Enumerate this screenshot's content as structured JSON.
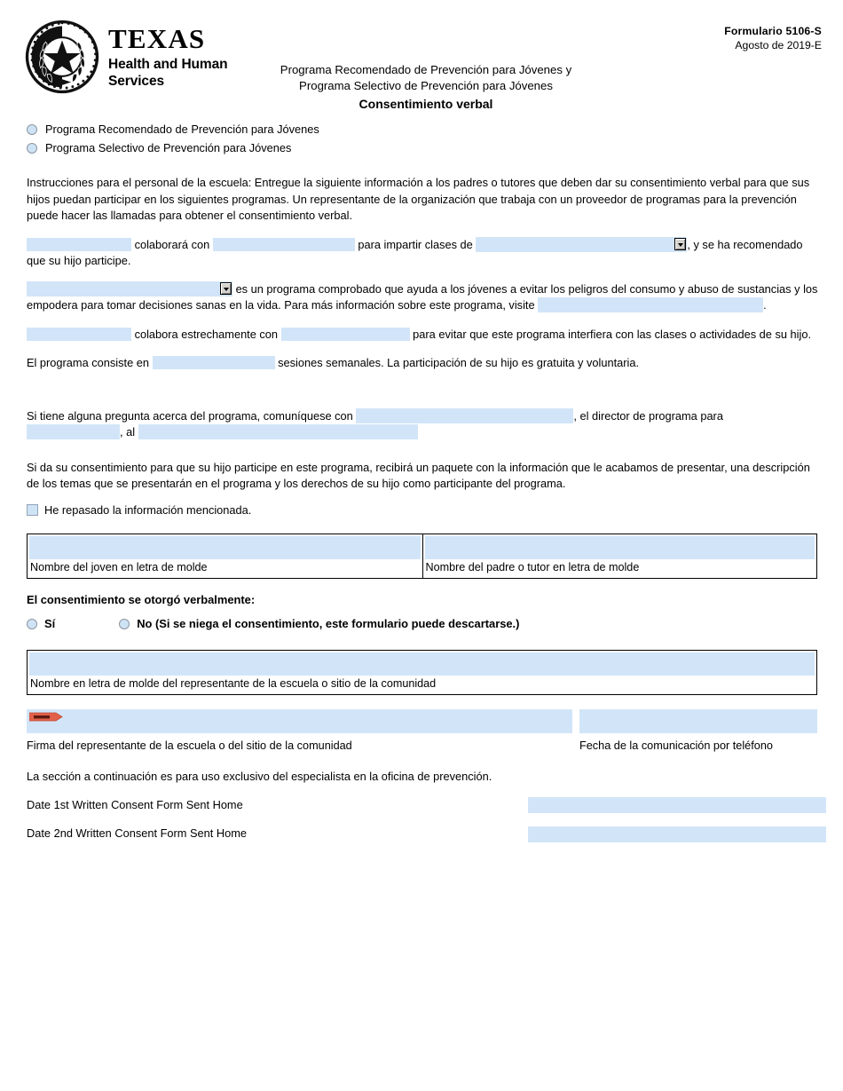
{
  "header": {
    "logo": {
      "seal_icon": "texas-state-seal-icon",
      "brand_primary": "TEXAS",
      "brand_secondary_line1": "Health and Human",
      "brand_secondary_line2": "Services"
    },
    "form_number": "Formulario  5106-S",
    "form_date": "Agosto de 2019-E",
    "title_line1": "Programa Recomendado de Prevención para Jóvenes y",
    "title_line2": "Programa Selectivo de Prevención para Jóvenes",
    "title_main": "Consentimiento verbal"
  },
  "program_options": [
    {
      "label": "Programa Recomendado de Prevención para Jóvenes",
      "selected": false
    },
    {
      "label": "Programa Selectivo de Prevención para Jóvenes",
      "selected": false
    }
  ],
  "instructions": "Instrucciones para el personal de la escuela: Entregue la siguiente información a los padres o tutores que deben dar su consentimiento verbal para que sus hijos puedan participar en los siguientes programas. Un representante de la organización que trabaja con un proveedor de programas para la prevención puede hacer las llamadas para obtener el consentimiento verbal.",
  "paragraph1": {
    "field1_value": "",
    "text1": "colaborará con",
    "field2_value": "",
    "text2": "para impartir clases de",
    "dropdown_value": "",
    "text3": ", y se ha recomendado que su hijo participe."
  },
  "paragraph2": {
    "dropdown_value": "",
    "text1": "es un programa comprobado que ayuda a los jóvenes a evitar los  peligros del consumo y abuso de sustancias y los empodera para tomar decisiones sanas en la vida. Para más información sobre este programa, visite",
    "url_field_value": "",
    "text2": "."
  },
  "paragraph3": {
    "field1_value": "",
    "text1": "colabora estrechamente con",
    "field2_value": "",
    "text2": "para evitar que este programa interfiera con las clases o actividades de su hijo."
  },
  "paragraph4": {
    "text1": "El programa consiste en",
    "field_value": "",
    "text2": "sesiones semanales. La participación de su hijo es gratuita y voluntaria."
  },
  "paragraph5": {
    "text1": "Si tiene alguna pregunta acerca del programa, comuníquese con",
    "contact_value": "",
    "text2": ", el director de programa para",
    "org_value": "",
    "text3": ", al",
    "phone_value": ""
  },
  "paragraph6": "Si da su consentimiento para que su hijo participe en este programa, recibirá un paquete con la información que le acabamos de presentar, una descripción de los temas que se presentarán en el programa y los derechos de su hijo como participante del programa.",
  "review_checkbox": {
    "label": "He repasado la información mencionada.",
    "checked": false
  },
  "name_table": {
    "youth": {
      "value": "",
      "caption": "Nombre del joven en letra de molde"
    },
    "parent": {
      "value": "",
      "caption": "Nombre del padre o tutor en letra de molde"
    }
  },
  "verbal_consent": {
    "question": "El consentimiento se otorgó verbalmente:",
    "yes_label": "Sí",
    "no_label": "No (Si se niega el consentimiento, este formulario puede descartarse.)"
  },
  "representative": {
    "value": "",
    "caption": "Nombre en letra de molde del representante de la escuela o sitio de la comunidad"
  },
  "signature": {
    "tag_icon": "signature-tag-icon",
    "value": "",
    "caption": "Firma del representante de la escuela o del sitio de la comunidad",
    "date_value": "",
    "date_caption": "Fecha de la comunicación por teléfono"
  },
  "office_use": {
    "note": "La sección a continuación es para uso exclusivo del especialista en la oficina de prevención.",
    "rows": [
      {
        "label": "Date 1st Written Consent Form Sent Home",
        "value": ""
      },
      {
        "label": "Date 2nd Written Consent Form Sent Home",
        "value": ""
      }
    ]
  },
  "colors": {
    "field_fill": "#d2e5f8",
    "radio_fill": "#cfe3f7",
    "signature_tag": "#e2604a",
    "border": "#000000"
  }
}
